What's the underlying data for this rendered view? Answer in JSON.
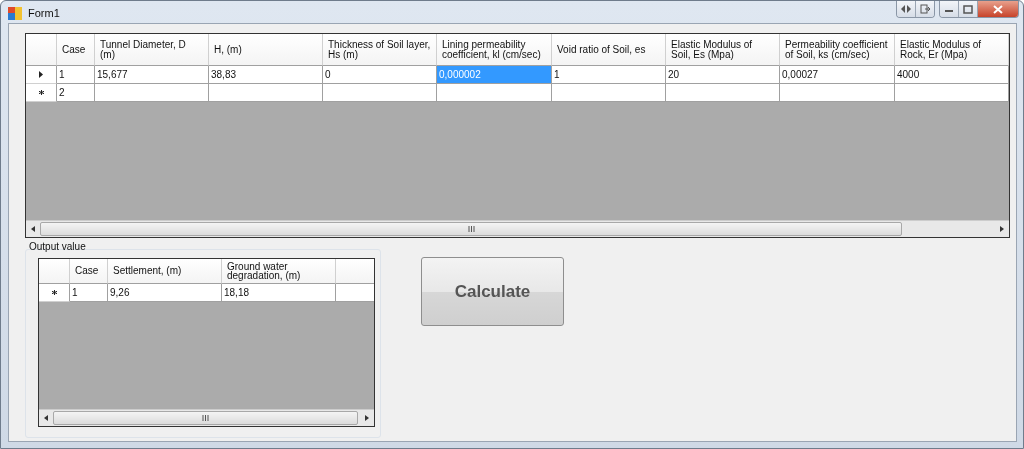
{
  "window": {
    "title": "Form1"
  },
  "input_grid": {
    "columns": [
      "Case",
      "Tunnel Diameter, D (m)",
      "H, (m)",
      "Thickness of Soil layer, Hs (m)",
      "Lining permeability coefficient, kl (cm/sec)",
      "Void ratio of Soil, es",
      "Elastic Modulus of Soil, Es (Mpa)",
      "Permeability coefficient of Soil, ks (cm/sec)",
      "Elastic Modulus of Rock, Er (Mpa)"
    ],
    "rows": [
      {
        "current": true,
        "new": false,
        "cells": [
          {
            "text": "1",
            "selected": false
          },
          {
            "text": "15,677",
            "selected": false
          },
          {
            "text": "38,83",
            "selected": false
          },
          {
            "text": "0",
            "selected": false
          },
          {
            "text": "0,000002",
            "selected": true
          },
          {
            "text": "1",
            "selected": false
          },
          {
            "text": "20",
            "selected": false
          },
          {
            "text": "0,00027",
            "selected": false
          },
          {
            "text": "4000",
            "selected": false
          }
        ]
      },
      {
        "current": false,
        "new": true,
        "cells": [
          {
            "text": "2",
            "selected": false
          }
        ]
      }
    ]
  },
  "output_group": {
    "title": "Output value",
    "grid": {
      "columns": [
        "Case",
        "Settlement, (m)",
        "Ground water degradation, (m)"
      ],
      "rows": [
        {
          "current": false,
          "new": true,
          "cells": [
            {
              "text": "1",
              "selected": false
            },
            {
              "text": "9,26",
              "selected": false
            },
            {
              "text": "18,18",
              "selected": false
            }
          ]
        }
      ]
    }
  },
  "calculate_button": {
    "label": "Calculate"
  }
}
